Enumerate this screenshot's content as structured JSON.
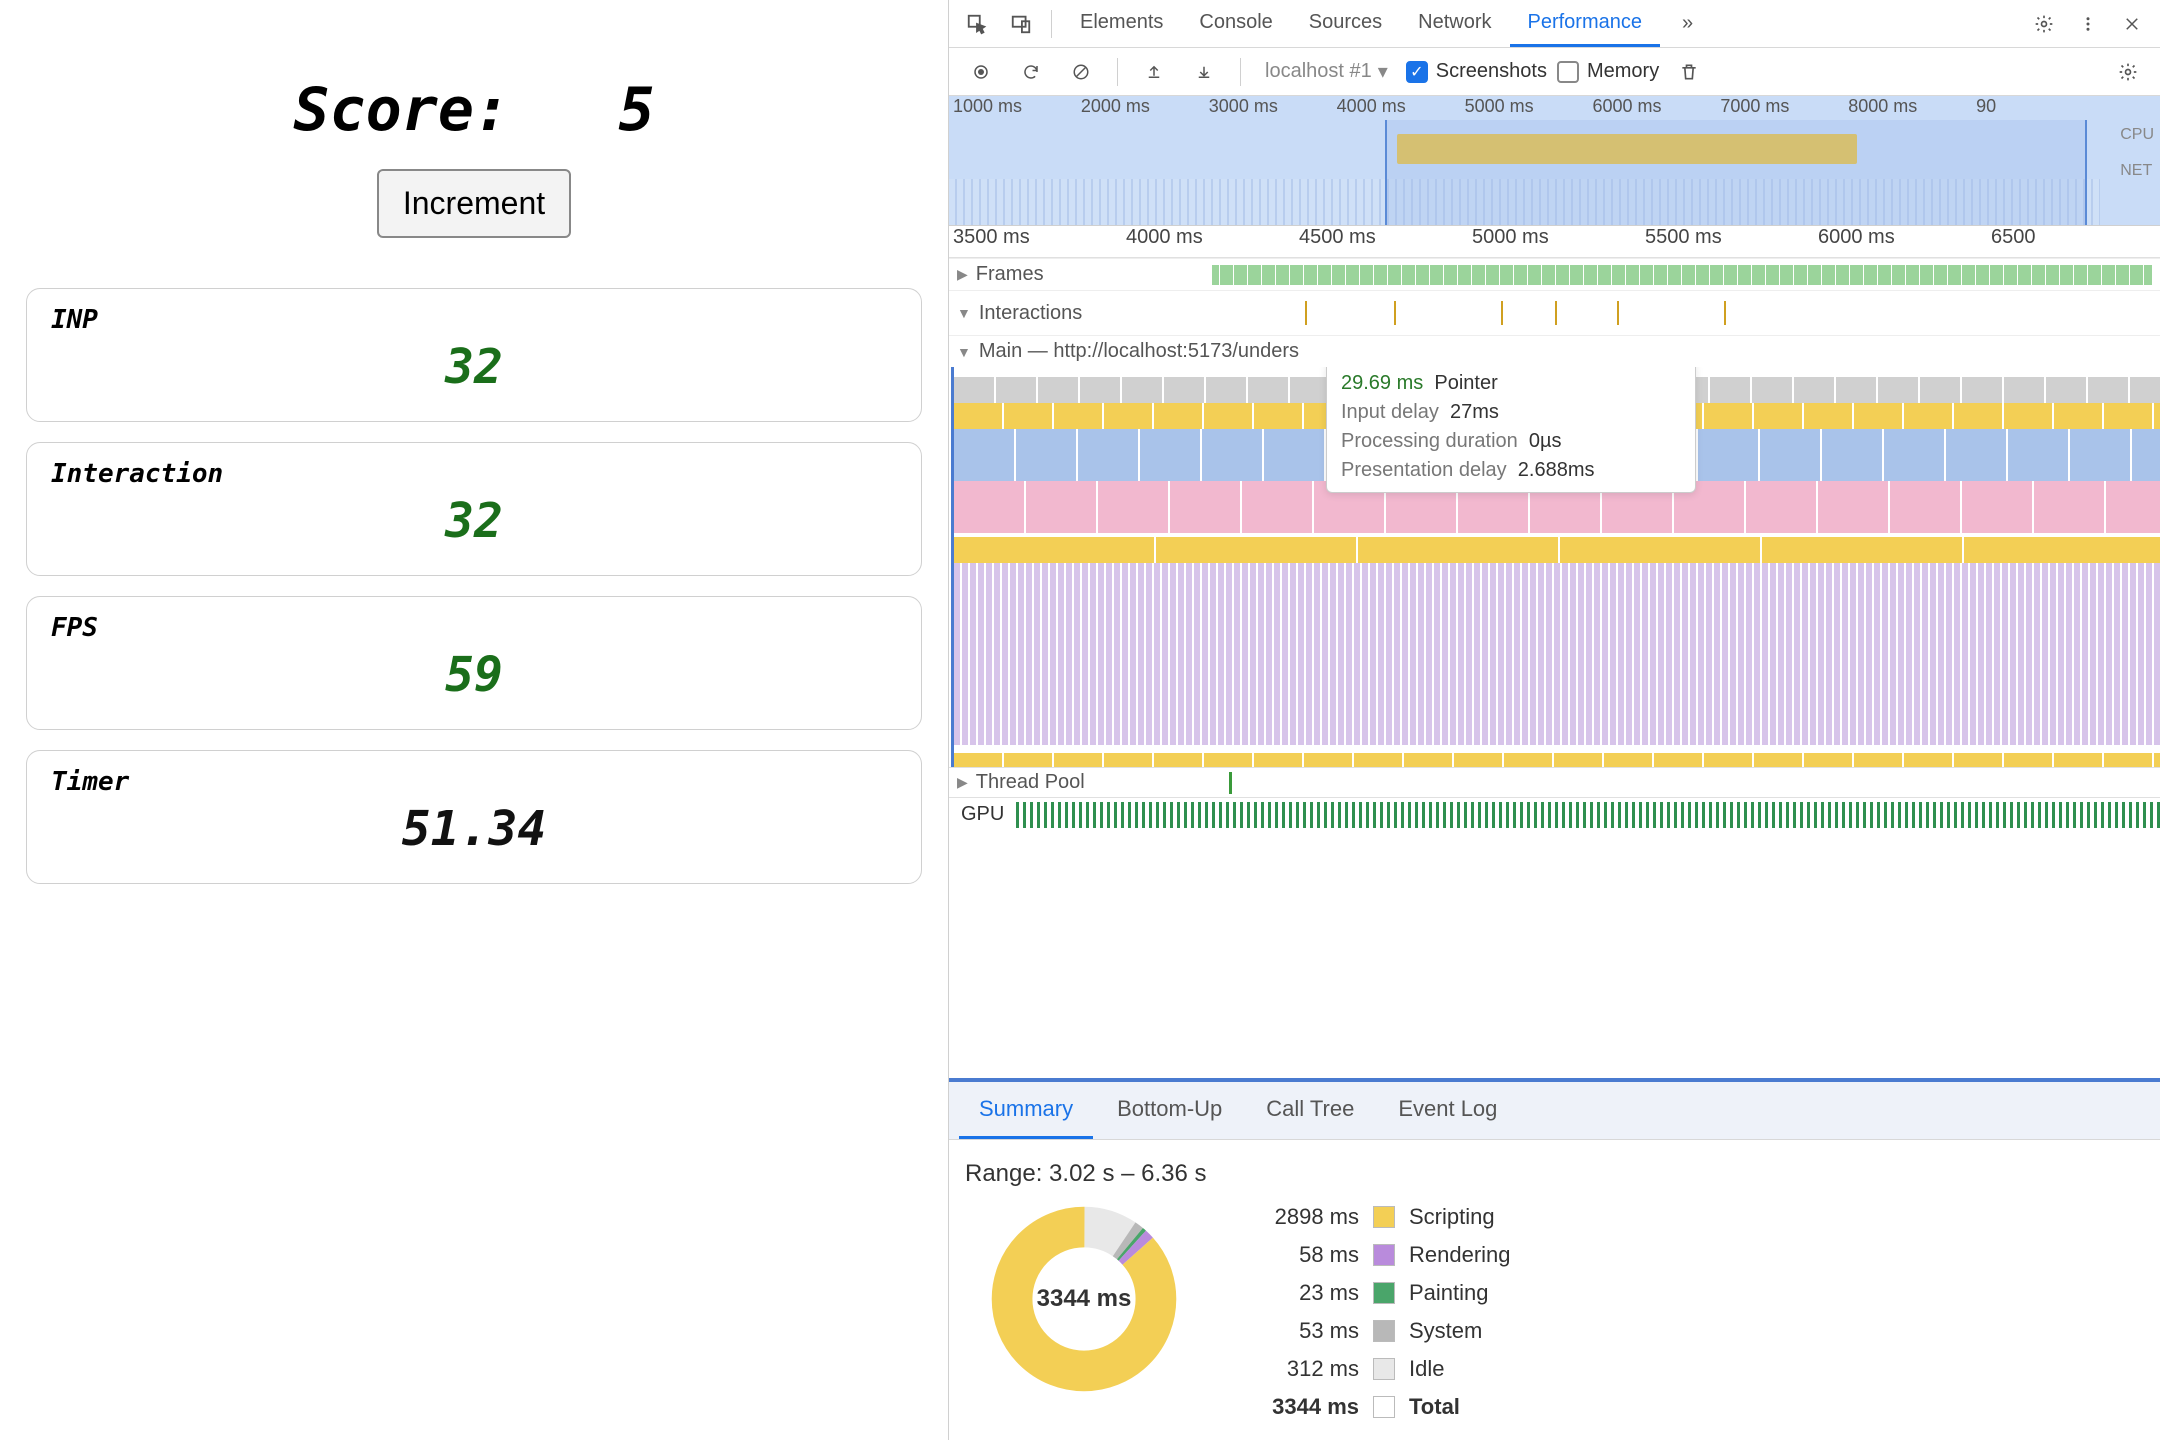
{
  "app": {
    "score_label": "Score:",
    "score_value": "5",
    "increment_label": "Increment",
    "cards": [
      {
        "label": "INP",
        "value": "32",
        "cls": "green"
      },
      {
        "label": "Interaction",
        "value": "32",
        "cls": "green"
      },
      {
        "label": "FPS",
        "value": "59",
        "cls": "green"
      },
      {
        "label": "Timer",
        "value": "51.34",
        "cls": "black"
      }
    ]
  },
  "devtools": {
    "tabs": [
      "Elements",
      "Console",
      "Sources",
      "Network",
      "Performance"
    ],
    "active_tab": "Performance",
    "more_tabs": "»",
    "toolbar": {
      "profile_select": "localhost #1",
      "screenshots_label": "Screenshots",
      "memory_label": "Memory"
    },
    "overview_ticks": [
      "1000 ms",
      "2000 ms",
      "3000 ms",
      "4000 ms",
      "5000 ms",
      "6000 ms",
      "7000 ms",
      "8000 ms",
      "90"
    ],
    "overview_side": {
      "cpu": "CPU",
      "net": "NET"
    },
    "ruler_ticks": [
      "3500 ms",
      "4000 ms",
      "4500 ms",
      "5000 ms",
      "5500 ms",
      "6000 ms",
      "6500"
    ],
    "lanes": {
      "frames": "Frames",
      "interactions": "Interactions",
      "main": "Main — http://localhost:5173/unders",
      "threadpool": "Thread Pool",
      "gpu": "GPU"
    },
    "tooltip": {
      "time": "29.69 ms",
      "event": "Pointer",
      "rows": [
        {
          "k": "Input delay",
          "v": "27ms"
        },
        {
          "k": "Processing duration",
          "v": "0µs"
        },
        {
          "k": "Presentation delay",
          "v": "2.688ms"
        }
      ]
    },
    "bottom_tabs": [
      "Summary",
      "Bottom-Up",
      "Call Tree",
      "Event Log"
    ],
    "active_bottom_tab": "Summary",
    "summary": {
      "range": "Range: 3.02 s – 6.36 s",
      "total": "3344 ms",
      "legend": [
        {
          "ms": "2898 ms",
          "label": "Scripting",
          "sw": "yellow"
        },
        {
          "ms": "58 ms",
          "label": "Rendering",
          "sw": "purple"
        },
        {
          "ms": "23 ms",
          "label": "Painting",
          "sw": "green"
        },
        {
          "ms": "53 ms",
          "label": "System",
          "sw": "grey"
        },
        {
          "ms": "312 ms",
          "label": "Idle",
          "sw": "lgrey"
        },
        {
          "ms": "3344 ms",
          "label": "Total",
          "sw": "white",
          "total": true
        }
      ]
    }
  },
  "chart_data": {
    "type": "pie",
    "title": "Performance Summary (donut)",
    "total_ms": 3344,
    "series": [
      {
        "name": "Scripting",
        "value_ms": 2898,
        "color": "#f3cf55"
      },
      {
        "name": "Rendering",
        "value_ms": 58,
        "color": "#b98bdc"
      },
      {
        "name": "Painting",
        "value_ms": 23,
        "color": "#4aa56a"
      },
      {
        "name": "System",
        "value_ms": 53,
        "color": "#b8b8b8"
      },
      {
        "name": "Idle",
        "value_ms": 312,
        "color": "#e8e8e8"
      }
    ]
  }
}
